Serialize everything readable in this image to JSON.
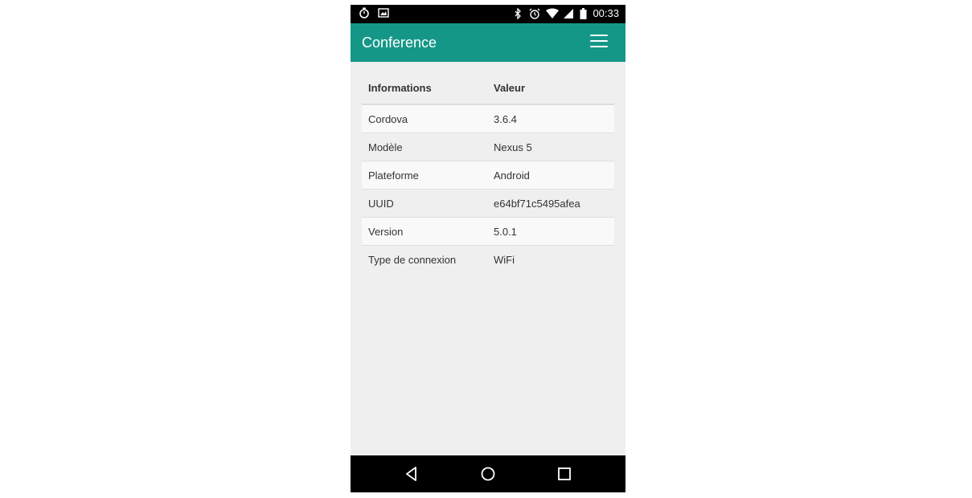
{
  "status_bar": {
    "time": "00:33",
    "left_icons": [
      "stopwatch-icon",
      "image-icon"
    ],
    "right_icons": [
      "bluetooth-icon",
      "alarm-icon",
      "wifi-icon",
      "signal-icon",
      "battery-icon"
    ]
  },
  "app_bar": {
    "title": "Conference",
    "menu_icon": "hamburger-menu-icon",
    "color": "#159788"
  },
  "table": {
    "headers": [
      "Informations",
      "Valeur"
    ],
    "rows": [
      {
        "label": "Cordova",
        "value": "3.6.4"
      },
      {
        "label": "Modèle",
        "value": "Nexus 5"
      },
      {
        "label": "Plateforme",
        "value": "Android"
      },
      {
        "label": "UUID",
        "value": "e64bf71c5495afea"
      },
      {
        "label": "Version",
        "value": "5.0.1"
      },
      {
        "label": "Type de connexion",
        "value": "WiFi"
      }
    ]
  },
  "nav_bar": {
    "buttons": [
      "back-icon",
      "home-icon",
      "recents-icon"
    ]
  }
}
